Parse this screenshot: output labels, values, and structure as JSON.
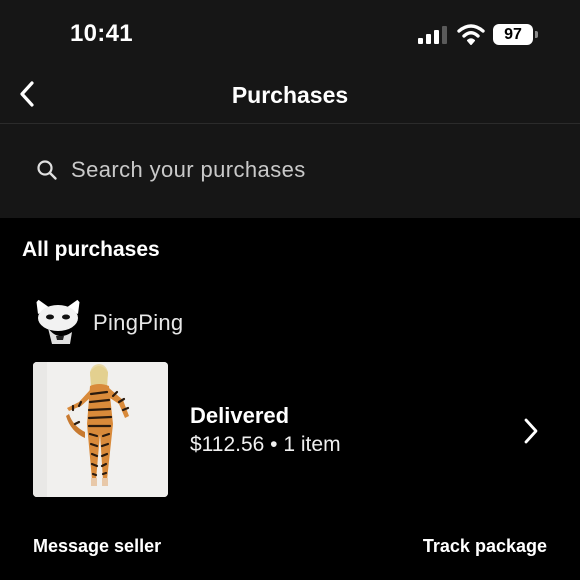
{
  "status_bar": {
    "time": "10:41",
    "battery_level": "97",
    "signal_bars": 3,
    "icons": [
      "signal-icon",
      "wifi-icon",
      "battery-icon"
    ]
  },
  "header": {
    "title": "Purchases",
    "back_icon": "chevron-left-icon"
  },
  "search": {
    "placeholder": "Search your purchases",
    "icon": "search-icon"
  },
  "section": {
    "title": "All purchases"
  },
  "orders": [
    {
      "seller": "PingPing",
      "status": "Delivered",
      "summary": "$112.56 • 1 item",
      "actions": {
        "message_seller": "Message seller",
        "track_package": "Track package"
      }
    }
  ],
  "colors": {
    "background": "#000000",
    "header_background": "#161616",
    "text": "#ffffff",
    "muted_text": "#c9c9c9"
  }
}
